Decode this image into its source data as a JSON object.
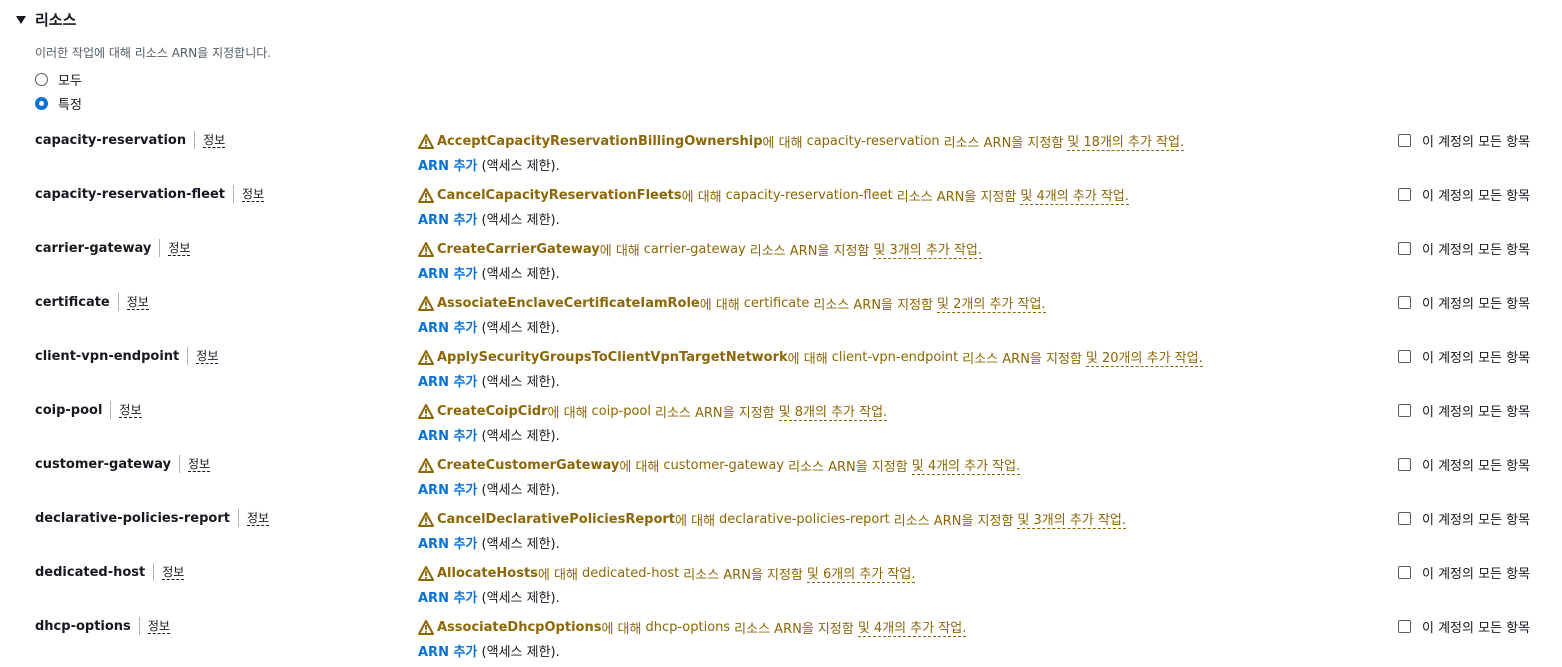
{
  "section": {
    "title": "리소스",
    "description": "이러한 작업에 대해 리소스 ARN을 지정합니다."
  },
  "radio": {
    "all_label": "모두",
    "specific_label": "특정",
    "selected": "specific"
  },
  "colors": {
    "warning": "#8d6605",
    "link": "#0972d3",
    "text": "#16191f"
  },
  "common": {
    "info": "정보",
    "for_text": "에 대해",
    "specify_text": "리소스 ARN을 지정함",
    "and_text": "및",
    "arn_add": "ARN 추가",
    "arn_suffix": "(액세스 제한).",
    "all_in_account": "이 계정의 모든 항목"
  },
  "resources": [
    {
      "name": "capacity-reservation",
      "action": "AcceptCapacityReservationBillingOwnership",
      "more": "18개의 추가 작업."
    },
    {
      "name": "capacity-reservation-fleet",
      "action": "CancelCapacityReservationFleets",
      "more": "4개의 추가 작업."
    },
    {
      "name": "carrier-gateway",
      "action": "CreateCarrierGateway",
      "more": "3개의 추가 작업."
    },
    {
      "name": "certificate",
      "action": "AssociateEnclaveCertificateIamRole",
      "more": "2개의 추가 작업."
    },
    {
      "name": "client-vpn-endpoint",
      "action": "ApplySecurityGroupsToClientVpnTargetNetwork",
      "more": "20개의 추가 작업."
    },
    {
      "name": "coip-pool",
      "action": "CreateCoipCidr",
      "more": "8개의 추가 작업."
    },
    {
      "name": "customer-gateway",
      "action": "CreateCustomerGateway",
      "more": "4개의 추가 작업."
    },
    {
      "name": "declarative-policies-report",
      "action": "CancelDeclarativePoliciesReport",
      "more": "3개의 추가 작업."
    },
    {
      "name": "dedicated-host",
      "action": "AllocateHosts",
      "more": "6개의 추가 작업."
    },
    {
      "name": "dhcp-options",
      "action": "AssociateDhcpOptions",
      "more": "4개의 추가 작업."
    }
  ]
}
